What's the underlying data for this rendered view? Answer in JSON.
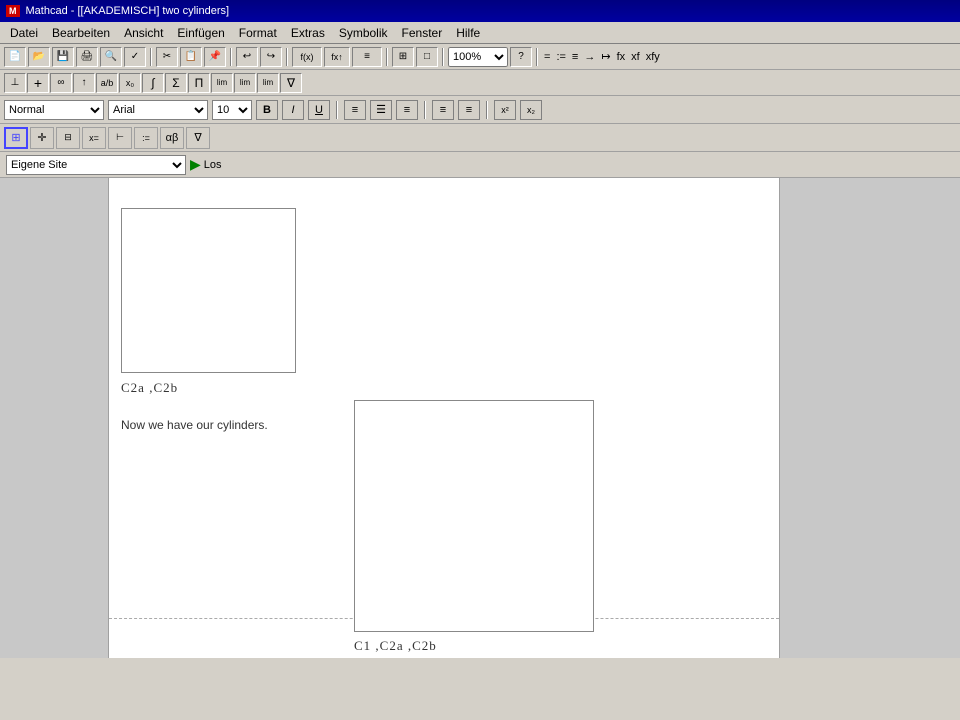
{
  "titlebar": {
    "icon": "M",
    "title": "Mathcad - [[AKADEMISCH] two cylinders]"
  },
  "menubar": {
    "items": [
      "Datei",
      "Bearbeiten",
      "Ansicht",
      "Einfügen",
      "Format",
      "Extras",
      "Symbolik",
      "Fenster",
      "Hilfe"
    ]
  },
  "toolbar1": {
    "zoom": "100%"
  },
  "format_toolbar": {
    "style": "Normal",
    "font": "Arial",
    "size": "10",
    "bold": "B",
    "italic": "I",
    "underline": "U"
  },
  "urlbar": {
    "site": "Eigene Site",
    "go_label": "Los"
  },
  "worksheet": {
    "plot1_label": "C2a ,C2b",
    "plot2_label": "C1 ,C2a ,C2b",
    "text_block": "Now we have our cylinders."
  }
}
